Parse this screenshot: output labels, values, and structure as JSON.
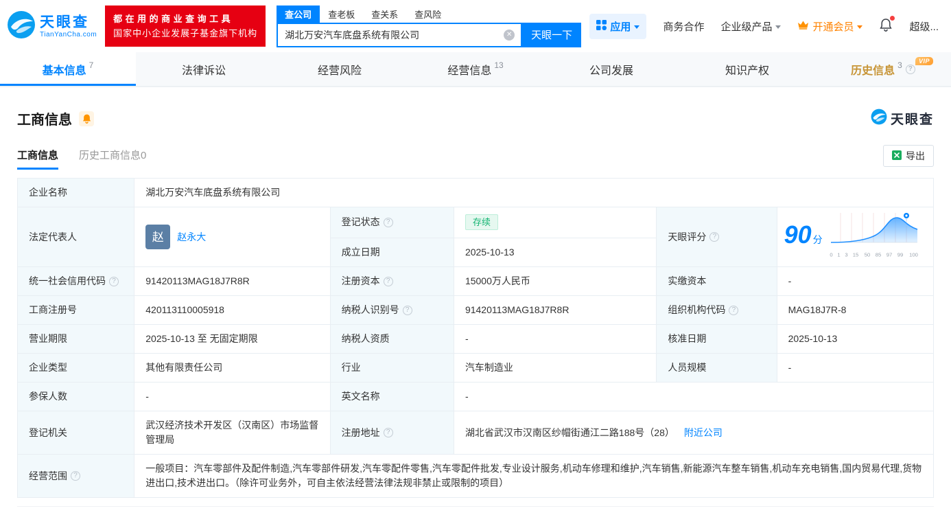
{
  "header": {
    "brand": "天眼查",
    "brand_domain": "TianYanCha.com",
    "promo_line1": "都在用的商业查询工具",
    "promo_line2": "国家中小企业发展子基金旗下机构",
    "search_tabs": [
      {
        "label": "查公司"
      },
      {
        "label": "查老板"
      },
      {
        "label": "查关系"
      },
      {
        "label": "查风险"
      }
    ],
    "search_value": "湖北万安汽车底盘系统有限公司",
    "search_button": "天眼一下",
    "menu_apps": "应用",
    "menu_biz": "商务合作",
    "menu_enterprise": "企业级产品",
    "menu_vip": "开通会员",
    "menu_super": "超级..."
  },
  "nav": {
    "vip_badge": "VIP",
    "tabs": [
      {
        "label": "基本信息",
        "count": "7"
      },
      {
        "label": "法律诉讼",
        "count": ""
      },
      {
        "label": "经营风险",
        "count": ""
      },
      {
        "label": "经营信息",
        "count": "13"
      },
      {
        "label": "公司发展",
        "count": ""
      },
      {
        "label": "知识产权",
        "count": ""
      },
      {
        "label": "历史信息",
        "count": "3"
      }
    ]
  },
  "section": {
    "title": "工商信息",
    "brand": "天眼查",
    "subtab_active": "工商信息",
    "subtab_history": "历史工商信息0",
    "export": "导出"
  },
  "fields": {
    "company_name": {
      "label": "企业名称",
      "value": "湖北万安汽车底盘系统有限公司"
    },
    "legal_rep": {
      "label": "法定代表人",
      "avatar": "赵",
      "value": "赵永大"
    },
    "reg_status": {
      "label": "登记状态",
      "value": "存续"
    },
    "establish_date": {
      "label": "成立日期",
      "value": "2025-10-13"
    },
    "score": {
      "label": "天眼评分",
      "value": "90",
      "unit": "分",
      "axis": [
        "0",
        "1",
        "3",
        "15",
        "50",
        "85",
        "97",
        "99",
        "100"
      ]
    },
    "credit_code": {
      "label": "统一社会信用代码",
      "value": "91420113MAG18J7R8R"
    },
    "reg_capital": {
      "label": "注册资本",
      "value": "15000万人民币"
    },
    "paid_capital": {
      "label": "实缴资本",
      "value": "-"
    },
    "reg_number": {
      "label": "工商注册号",
      "value": "420113110005918"
    },
    "taxpayer_id": {
      "label": "纳税人识别号",
      "value": "91420113MAG18J7R8R"
    },
    "org_code": {
      "label": "组织机构代码",
      "value": "MAG18J7R-8"
    },
    "business_term": {
      "label": "营业期限",
      "value": "2025-10-13 至 无固定期限"
    },
    "taxpayer_qual": {
      "label": "纳税人资质",
      "value": "-"
    },
    "approval_date": {
      "label": "核准日期",
      "value": "2025-10-13"
    },
    "company_type": {
      "label": "企业类型",
      "value": "其他有限责任公司"
    },
    "industry": {
      "label": "行业",
      "value": "汽车制造业"
    },
    "staff_size": {
      "label": "人员规模",
      "value": "-"
    },
    "insured_count": {
      "label": "参保人数",
      "value": "-"
    },
    "english_name": {
      "label": "英文名称",
      "value": "-"
    },
    "reg_authority": {
      "label": "登记机关",
      "value": "武汉经济技术开发区（汉南区）市场监督管理局"
    },
    "reg_address": {
      "label": "注册地址",
      "value": "湖北省武汉市汉南区纱帽街通江二路188号（28）",
      "link": "附近公司"
    },
    "business_scope": {
      "label": "经营范围",
      "value": "一般项目：汽车零部件及配件制造,汽车零部件研发,汽车零配件零售,汽车零配件批发,专业设计服务,机动车修理和维护,汽车销售,新能源汽车整车销售,机动车充电销售,国内贸易代理,货物进出口,技术进出口。（除许可业务外，可自主依法经营法律法规非禁止或限制的项目）"
    }
  }
}
